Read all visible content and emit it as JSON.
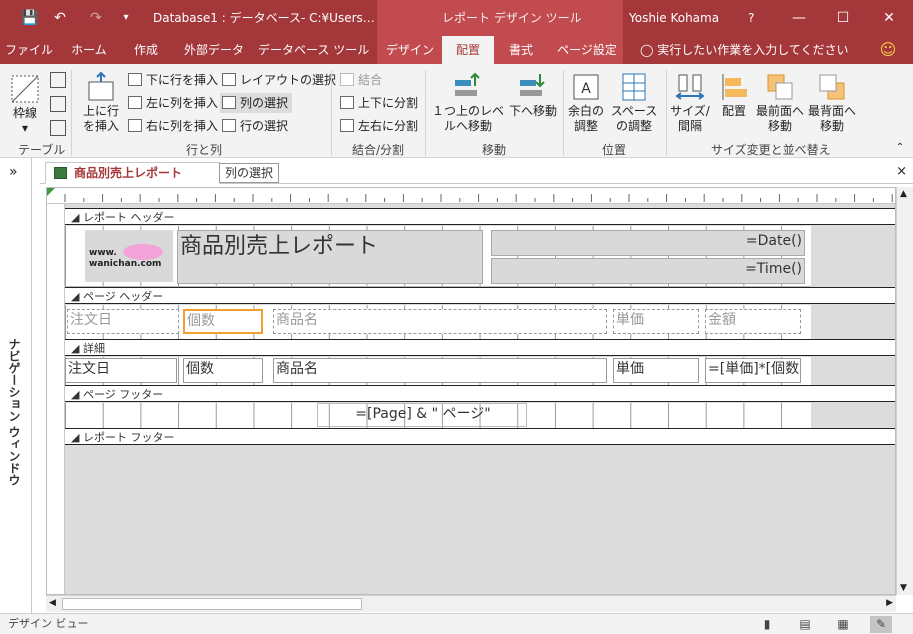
{
  "title_bar": {
    "document_title": "Database1 : データベース- C:¥Users…",
    "context_title": "レポート デザイン ツール",
    "user_name": "Yoshie Kohama",
    "help": "?",
    "save_icon": "save-icon",
    "undo_icon": "undo-icon",
    "redo_icon": "redo-icon",
    "qat_icon": "customize-icon",
    "minimize_icon": "minimize-icon",
    "restore_icon": "restore-icon",
    "close_icon": "close-icon"
  },
  "tabs": [
    "ファイル",
    "ホーム",
    "作成",
    "外部データ",
    "データベース ツール",
    "デザイン",
    "配置",
    "書式",
    "ページ設定"
  ],
  "active_tab": "配置",
  "tell_me": "実行したい作業を入力してください",
  "ribbon": {
    "table_group": {
      "btn": "枠線",
      "label": "テーブル"
    },
    "rows_cols_group": {
      "insert_above": "上に行を挿入",
      "insert_below": "下に行を挿入",
      "insert_left": "左に列を挿入",
      "insert_right": "右に列を挿入",
      "select_layout": "レイアウトの選択",
      "select_column": "列の選択",
      "select_row": "行の選択",
      "label": "行と列"
    },
    "merge_group": {
      "merge": "結合",
      "split_v": "上下に分割",
      "split_h": "左右に分割",
      "label": "結合/分割"
    },
    "move_group": {
      "move_up": "１つ上のレベルへ移動",
      "move_down": "下へ移動",
      "label": "移動"
    },
    "position_group": {
      "margins": "余白の調整",
      "padding": "スペースの調整",
      "label": "位置"
    },
    "size_group": {
      "size": "サイズ/間隔",
      "align": "配置",
      "front": "最前面へ移動",
      "back": "最背面へ移動",
      "label": "サイズ変更と並べ替え"
    }
  },
  "nav_pane": {
    "label": "ナビゲーション ウィンドウ",
    "toggle": "»"
  },
  "document_tab": {
    "label": "商品別売上レポート",
    "close": "×"
  },
  "tooltip": "列の選択",
  "report": {
    "sections": {
      "report_header": "レポート ヘッダー",
      "page_header": "ページ ヘッダー",
      "detail": "詳細",
      "page_footer": "ページ フッター",
      "report_footer": "レポート フッター"
    },
    "title": "商品別売上レポート",
    "logo_text": "www.\nwanichan.com",
    "date_expr": "=Date()",
    "time_expr": "=Time()",
    "header_labels": [
      "注文日",
      "個数",
      "商品名",
      "単価",
      "金額"
    ],
    "detail_fields": [
      "注文日",
      "個数",
      "商品名",
      "単価",
      "=[単価]*[個数]"
    ],
    "page_expr": "=[Page] & \" ページ\""
  },
  "status_bar": {
    "text": "デザイン ビュー"
  },
  "colors": {
    "accent": "#a4373a",
    "context": "#c14b4e",
    "selection": "#f0a030"
  }
}
